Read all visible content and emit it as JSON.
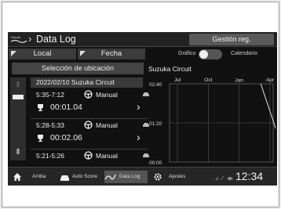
{
  "header": {
    "brand_logo_text": "Honda",
    "title": "Data Log",
    "register_button": "Gestión reg."
  },
  "tabs": [
    {
      "label": "Local"
    },
    {
      "label": "Fecha"
    }
  ],
  "view_toggle": {
    "left_label": "Gráfico",
    "right_label": "Calendario"
  },
  "location_button": "Selección de ubicación",
  "circuit_name": "Suzuka Circuit",
  "list": {
    "date_header": "2022/02/10  Suzuka Circuit",
    "entries": [
      {
        "time": "5:35-7:12",
        "mode": "Manual",
        "lap": "00:01.04"
      },
      {
        "time": "5:28-5:33",
        "mode": "Manual",
        "lap": "00:02.06"
      },
      {
        "time": "5:21-5:26",
        "mode": "Manual",
        "lap": ""
      }
    ]
  },
  "chart_data": {
    "type": "line",
    "y_ticks": [
      "02:40",
      "01:20",
      "00:00"
    ],
    "x_ticks": [
      "Jul",
      "Oct",
      "2022\nJan",
      "Apr"
    ],
    "ylim": [
      0,
      160
    ],
    "series": [
      {
        "points": [
          [
            2.7,
            160
          ],
          [
            3.1,
            85
          ],
          [
            3.5,
            6
          ],
          [
            3.9,
            6
          ]
        ]
      }
    ]
  },
  "bottom_nav": {
    "items": [
      {
        "label": ""
      },
      {
        "label": "Arriba"
      },
      {
        "label": "Auto Score"
      },
      {
        "label": "Data Log"
      },
      {
        "label": "Ajustes"
      }
    ],
    "clock": "12:34"
  }
}
